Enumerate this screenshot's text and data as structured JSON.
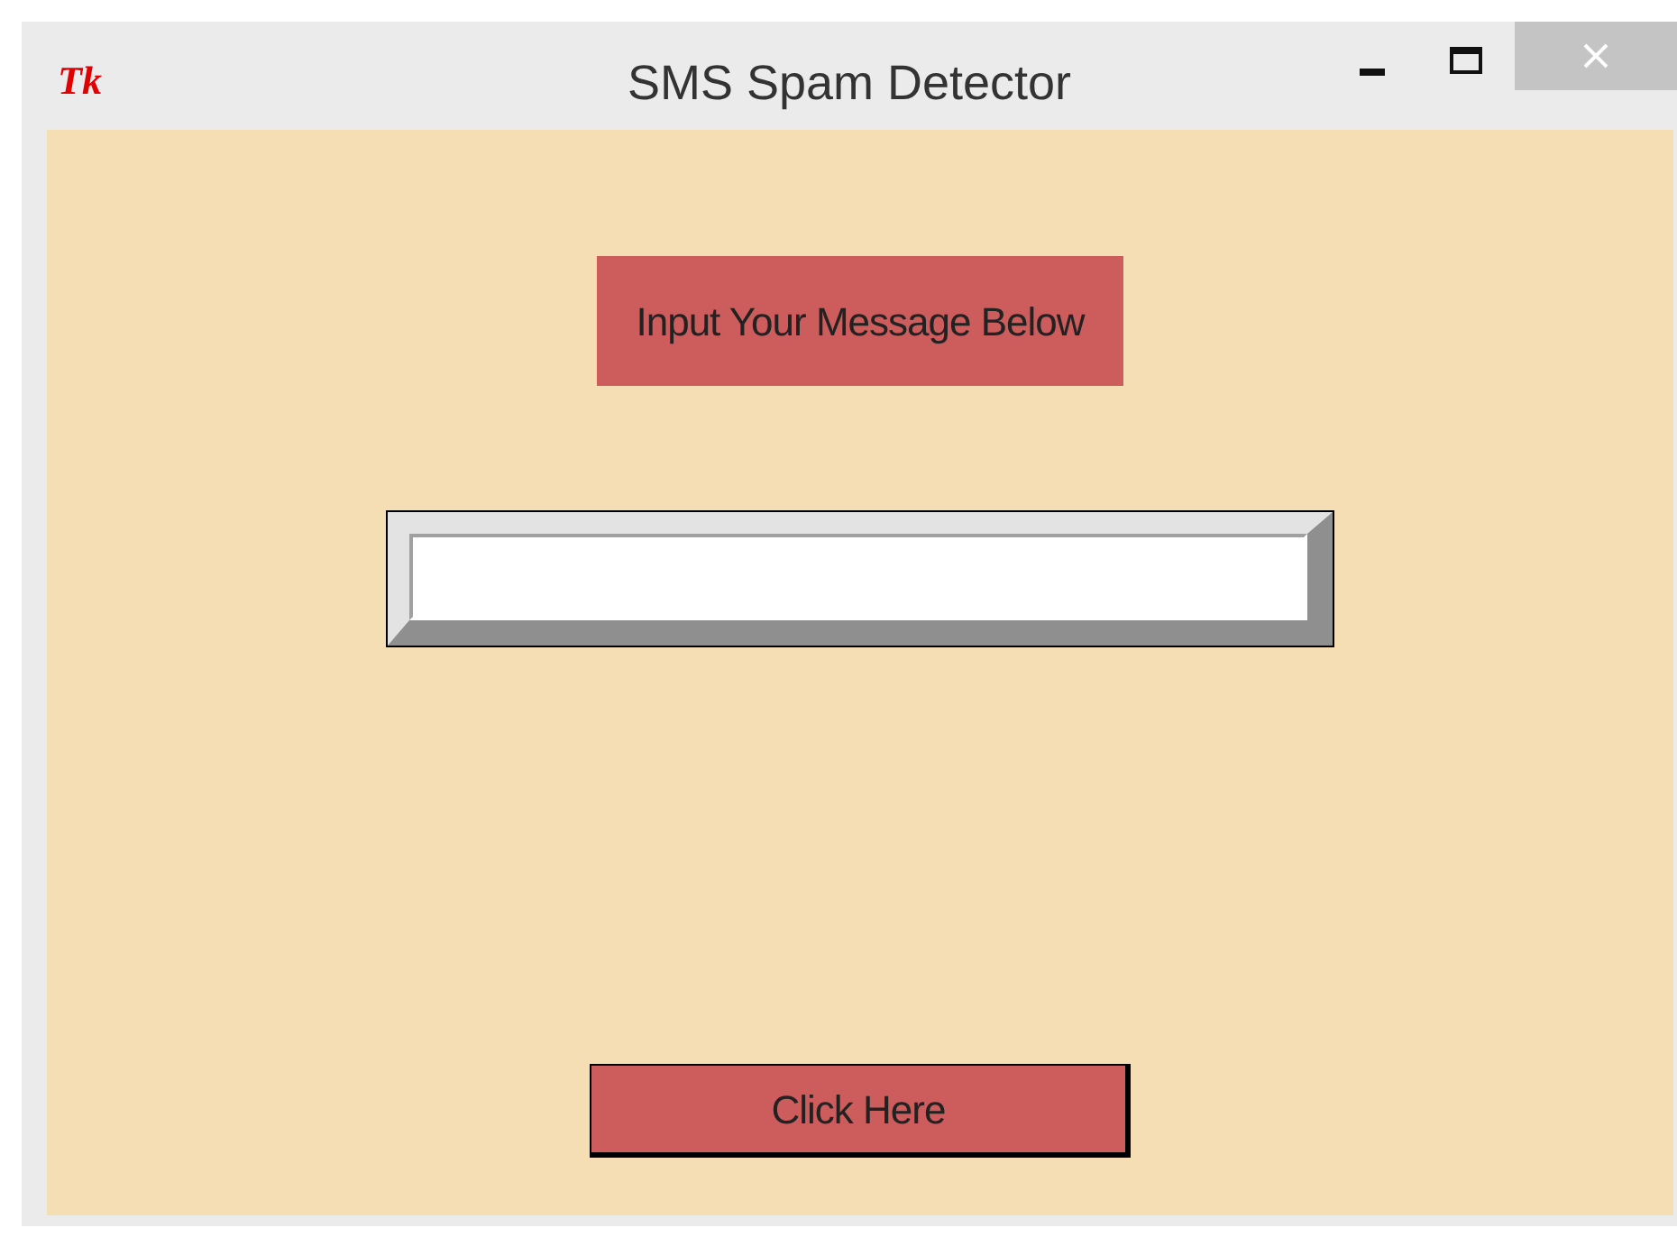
{
  "window": {
    "icon_text": "Tk",
    "title": "SMS Spam Detector"
  },
  "heading": "Input Your Message Below",
  "button": "Click Here"
}
